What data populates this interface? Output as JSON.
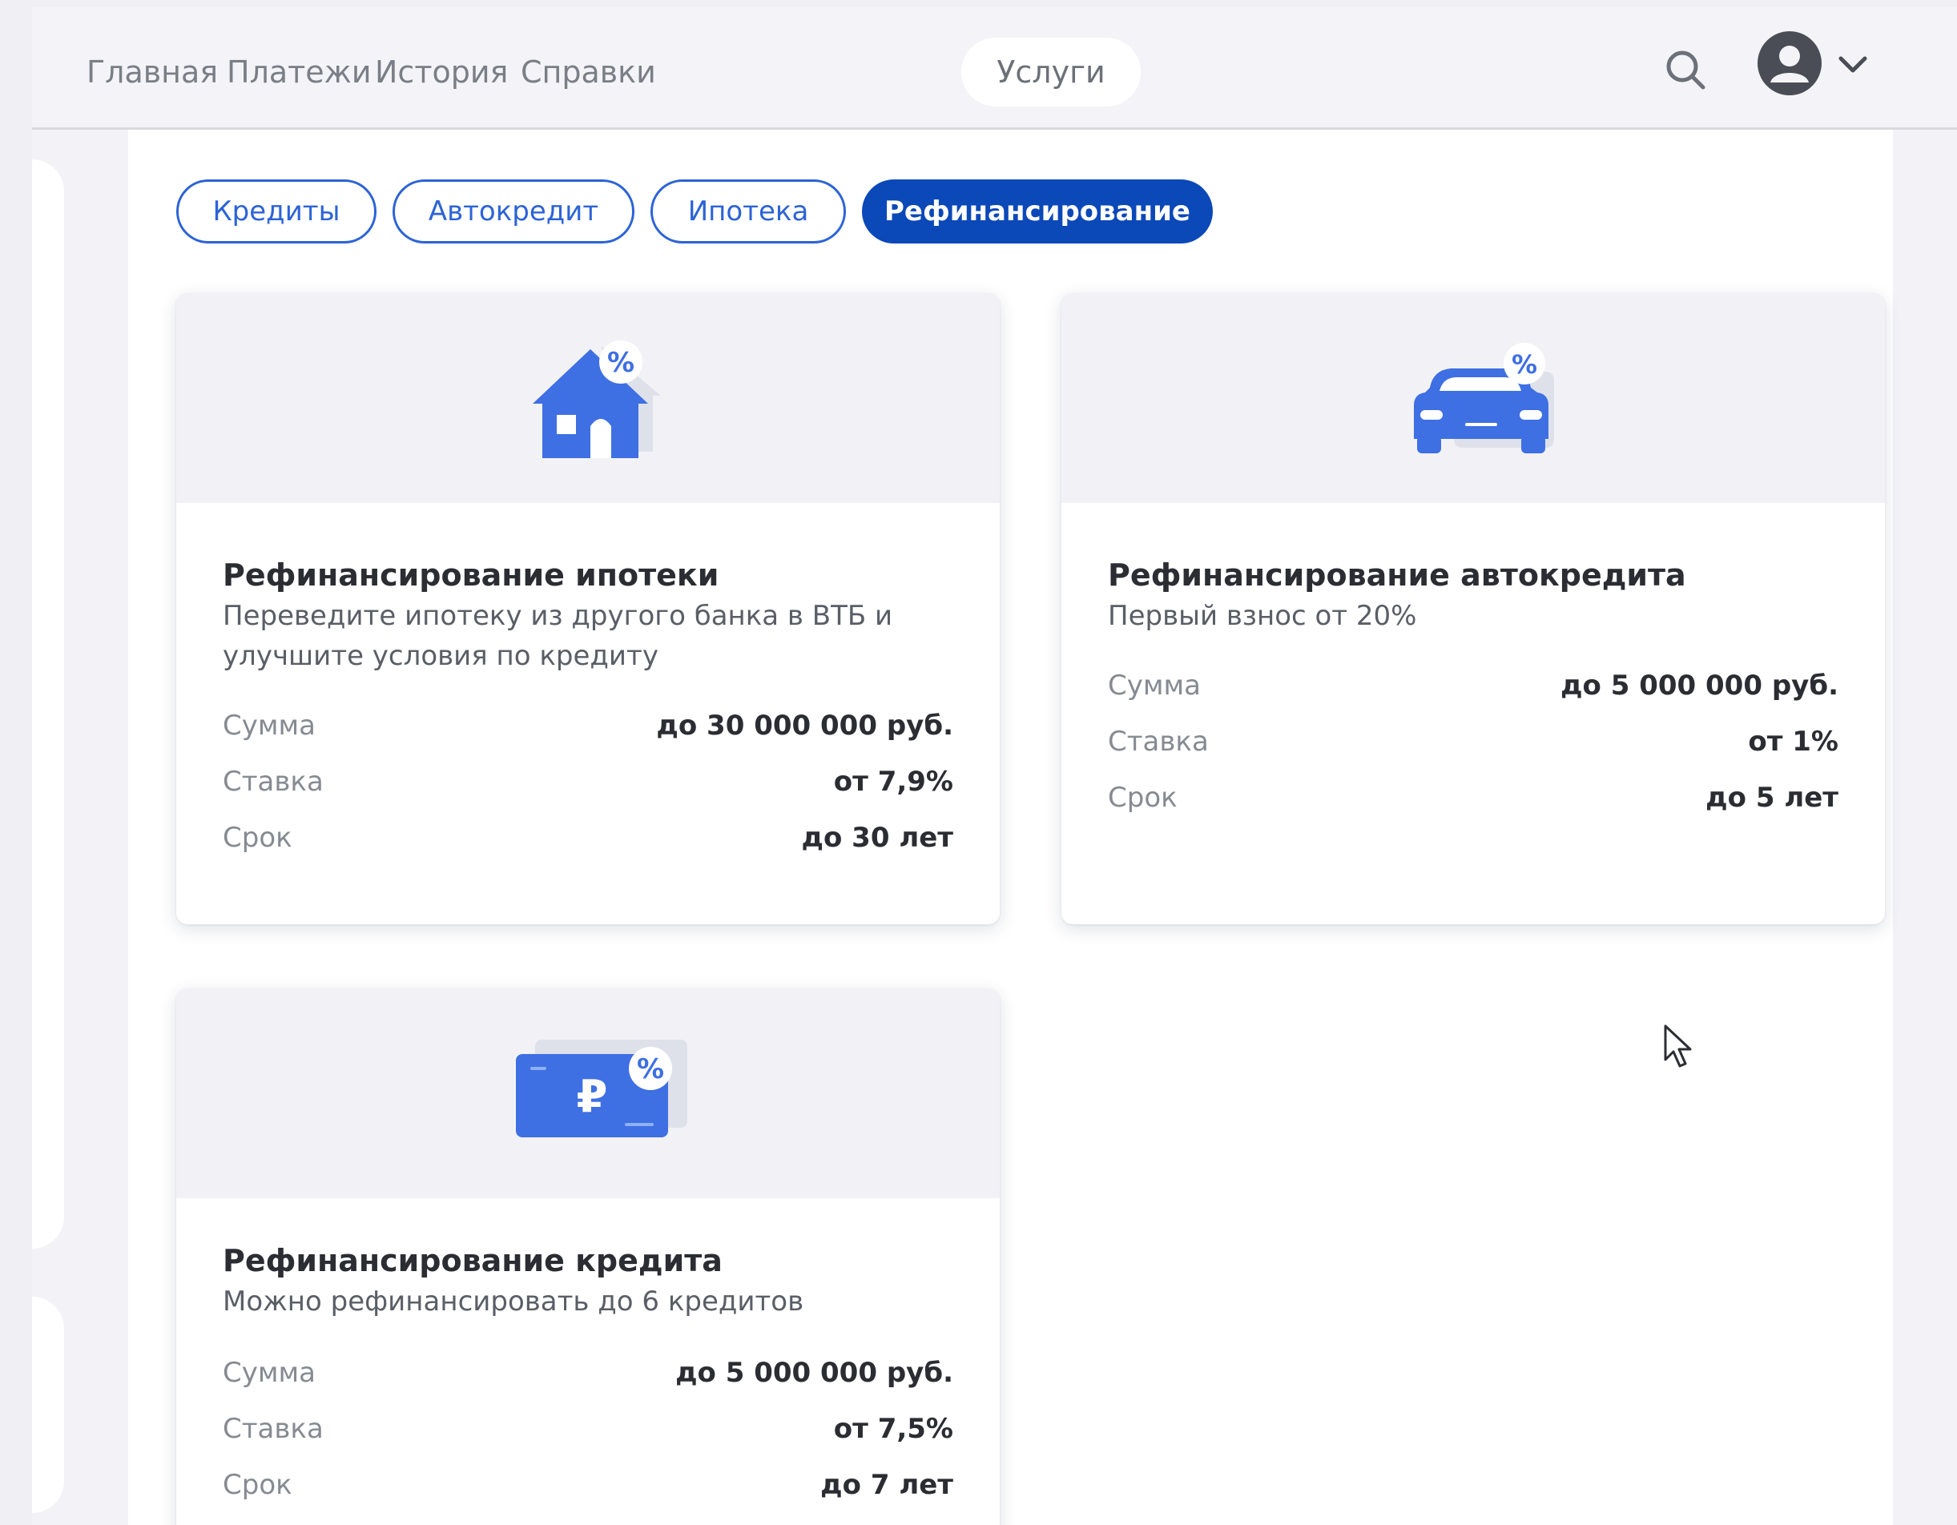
{
  "nav": {
    "items": [
      {
        "label": "Главная"
      },
      {
        "label": "Платежи"
      },
      {
        "label": "История"
      },
      {
        "label": "Справки"
      },
      {
        "label": "Услуги",
        "active": true
      }
    ],
    "icons": {
      "search": "search-icon",
      "profile": "user-icon",
      "menu": "chevron-down-icon"
    }
  },
  "filters": [
    {
      "label": "Кредиты"
    },
    {
      "label": "Автокредит"
    },
    {
      "label": "Ипотека"
    },
    {
      "label": "Рефинансирование",
      "active": true
    }
  ],
  "cards": [
    {
      "icon": "house-percent-icon",
      "title": "Рефинансирование ипотеки",
      "description": "Переведите ипотеку из другого банка в ВТБ и улучшите условия по кредиту",
      "rows": [
        {
          "label": "Сумма",
          "value": "до 30 000 000 руб."
        },
        {
          "label": "Ставка",
          "value": "от 7,9%"
        },
        {
          "label": "Срок",
          "value": "до 30 лет"
        }
      ]
    },
    {
      "icon": "car-percent-icon",
      "title": "Рефинансирование автокредита",
      "description": "Первый взнос от 20%",
      "rows": [
        {
          "label": "Сумма",
          "value": "до 5 000 000 руб."
        },
        {
          "label": "Ставка",
          "value": "от 1%"
        },
        {
          "label": "Срок",
          "value": "до 5 лет"
        }
      ]
    },
    {
      "icon": "ruble-card-percent-icon",
      "title": "Рефинансирование кредита",
      "description": "Можно рефинансировать до 6 кредитов",
      "rows": [
        {
          "label": "Сумма",
          "value": "до 5 000 000 руб."
        },
        {
          "label": "Ставка",
          "value": "от 7,5%"
        },
        {
          "label": "Срок",
          "value": "до 7 лет"
        }
      ]
    }
  ],
  "colors": {
    "accent": "#2c63d6",
    "accent_dark": "#0b48b8",
    "illustration": "#3e6fe3",
    "background": "#efeff4"
  }
}
